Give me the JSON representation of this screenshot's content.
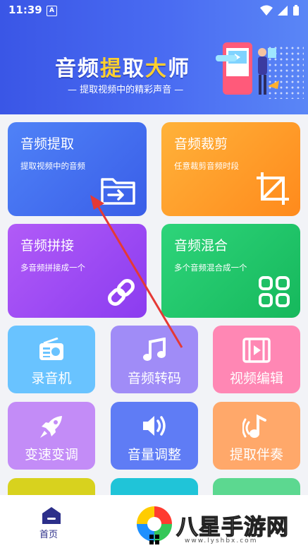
{
  "status_bar": {
    "time": "11:39",
    "notif_letter": "A"
  },
  "banner": {
    "title_part1": "音频",
    "title_hl1": "提",
    "title_part2": "取",
    "title_hl2": "大",
    "title_part3": "师",
    "subtitle": "— 提取视频中的精彩声音 —"
  },
  "cards_big": [
    {
      "title": "音频提取",
      "desc": "提取视频中的音频",
      "icon": "folder-import-icon",
      "color": "#3f6ef0"
    },
    {
      "title": "音频裁剪",
      "desc": "任意裁剪音频时段",
      "icon": "crop-icon",
      "color": "#ff9a2b"
    },
    {
      "title": "音频拼接",
      "desc": "多音频拼接成一个",
      "icon": "link-icon",
      "color": "#9b4cf2"
    },
    {
      "title": "音频混合",
      "desc": "多个音频混合成一个",
      "icon": "grid-icon",
      "color": "#22c46a"
    }
  ],
  "cards_small": [
    {
      "title": "录音机",
      "icon": "radio-icon",
      "color": "#69c3ff"
    },
    {
      "title": "音频转码",
      "icon": "music-note-icon",
      "color": "#a08cf7"
    },
    {
      "title": "视频编辑",
      "icon": "film-icon",
      "color": "#ff87b4"
    },
    {
      "title": "变速变调",
      "icon": "rocket-icon",
      "color": "#c38cf7"
    },
    {
      "title": "音量调整",
      "icon": "speaker-icon",
      "color": "#5f7cf5"
    },
    {
      "title": "提取伴奏",
      "icon": "music-wave-icon",
      "color": "#ffa86a"
    }
  ],
  "cards_partial": [
    {
      "color": "#d8d21e"
    },
    {
      "color": "#20c4d8"
    },
    {
      "color": "#5cd890"
    }
  ],
  "nav": {
    "home_label": "首页"
  },
  "watermark": {
    "text": "八星手游网",
    "url": "www.lyshbx.com"
  }
}
